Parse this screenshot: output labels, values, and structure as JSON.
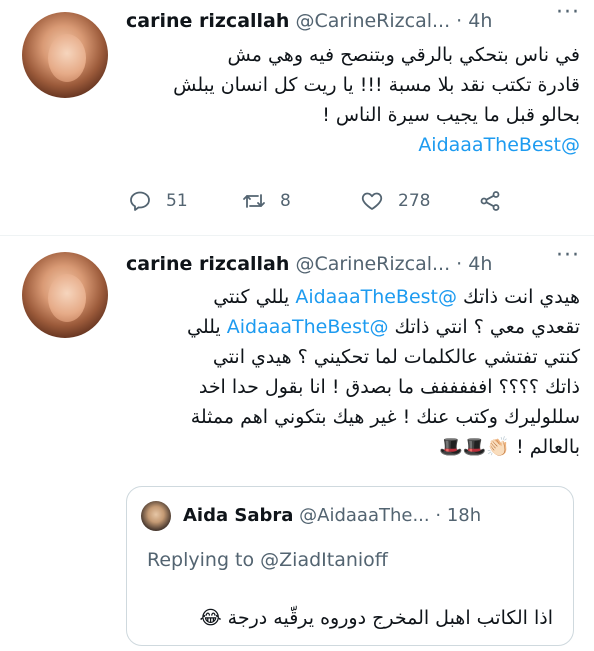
{
  "tweets": [
    {
      "author_name": "carine rizcallah",
      "author_handle": "@CarineRizcal...",
      "separator": "·",
      "time": "4h",
      "text_lines": [
        "في ناس بتحكي بالرقي وبتنصح فيه وهي مش",
        "قادرة تكتب نقد بلا مسبة !!! يا ريت كل انسان يبلش",
        "بحالو قبل ما يجيب سيرة الناس !",
        "@AidaaaTheBest"
      ],
      "reply_count": "51",
      "retweet_count": "8",
      "like_count": "278"
    },
    {
      "author_name": "carine rizcallah",
      "author_handle": "@CarineRizcal...",
      "separator": "·",
      "time": "4h",
      "line1_pre": "هيدي انت ذاتك ",
      "line1_mention": "@AidaaaTheBest",
      "line1_post": " يللي كنتي",
      "line2_pre": "تقعدي معي ؟ انتي ذاتك ",
      "line2_mention": "@AidaaaTheBest",
      "line2_post": " يللي",
      "line3": "كنتي تفتشي عالكلمات لما تحكيني ؟ هيدي انتي",
      "line4": "ذاتك ؟؟؟؟ افففففف ما بصدق ! انا بقول حدا اخد",
      "line5": "سللوليرك وكتب عنك ! غير هيك بتكوني اهم ممثلة",
      "line6": "بالعالم ! 👏🏻🎩🎩",
      "quote": {
        "author_name": "Aida Sabra",
        "author_handle": "@AidaaaThe...",
        "separator": "·",
        "time": "18h",
        "replying_to": "Replying to @ZiadItanioff",
        "text": "اذا الكاتب اهبل المخرج دوروه يرقّيه درجة 😂"
      }
    }
  ],
  "more_glyph": "···",
  "colors": {
    "link": "#1d9bf0",
    "muted": "#536471",
    "text": "#0f1419"
  }
}
